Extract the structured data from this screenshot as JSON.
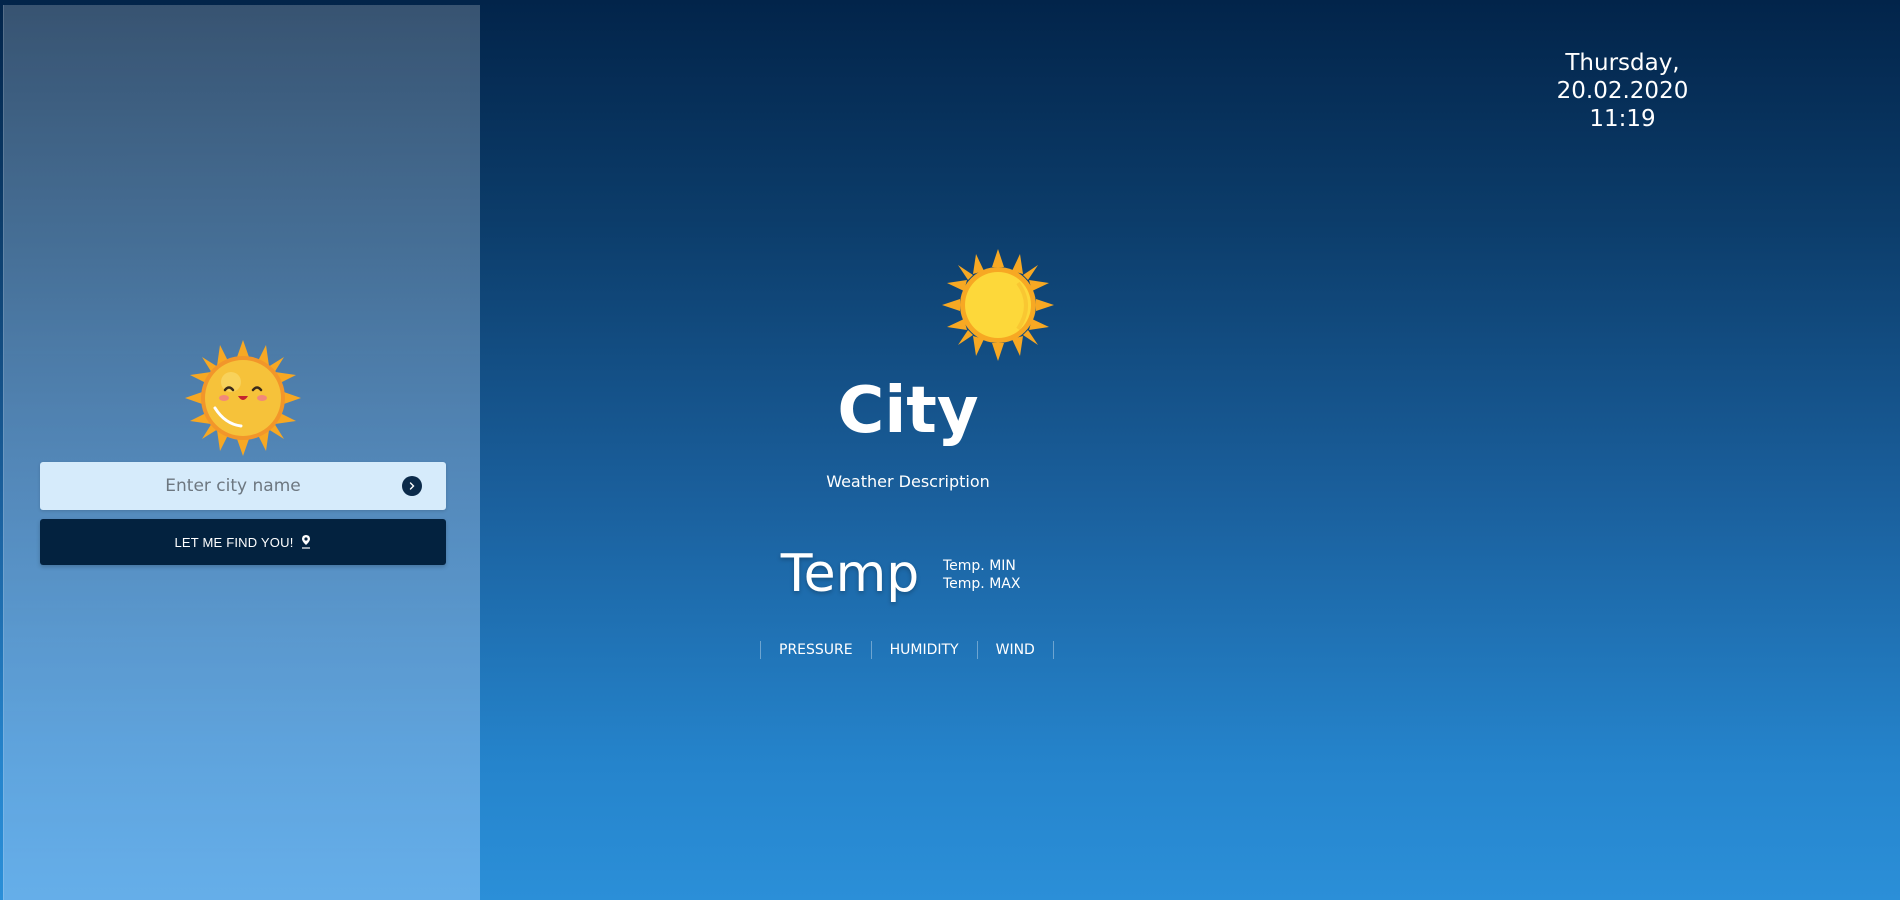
{
  "sidebar": {
    "search": {
      "placeholder": "Enter city name"
    },
    "locate_button": "LET ME FIND YOU!"
  },
  "datetime": {
    "date": "Thursday, 20.02.2020",
    "time": "11:19"
  },
  "weather": {
    "city": "City",
    "description": "Weather Description",
    "temp": "Temp",
    "temp_min": "Temp. MIN",
    "temp_max": "Temp. MAX",
    "stats": [
      "PRESSURE",
      "HUMIDITY",
      "WIND"
    ]
  },
  "icons": {
    "sidebar": "happy-sun-icon",
    "weather": "sun-icon",
    "search": "arrow-right-icon",
    "locate": "map-pin-icon"
  },
  "colors": {
    "button_dark": "#03223f",
    "search_bg": "#d6ebfb",
    "sun_yellow": "#fdd83a",
    "sun_orange": "#f7a823"
  }
}
